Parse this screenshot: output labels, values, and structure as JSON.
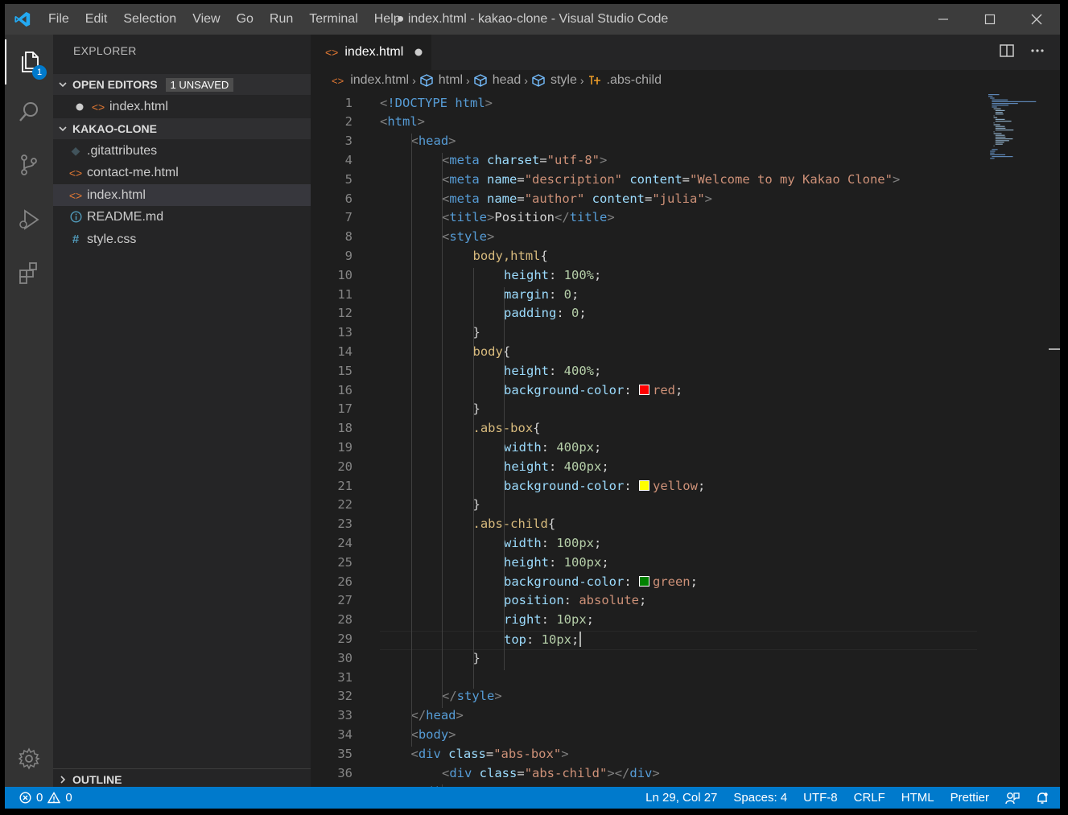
{
  "window": {
    "title": "● index.html - kakao-clone - Visual Studio Code",
    "menu": [
      "File",
      "Edit",
      "Selection",
      "View",
      "Go",
      "Run",
      "Terminal",
      "Help"
    ]
  },
  "activity": {
    "explorer_badge": "1"
  },
  "sidebar": {
    "title": "EXPLORER",
    "open_editors": {
      "label": "OPEN EDITORS",
      "badge": "1 UNSAVED",
      "file": "index.html"
    },
    "project": {
      "label": "KAKAO-CLONE",
      "files": [
        {
          "name": ".gitattributes",
          "icon": "git-icon"
        },
        {
          "name": "contact-me.html",
          "icon": "html-icon"
        },
        {
          "name": "index.html",
          "icon": "html-icon",
          "selected": true
        },
        {
          "name": "README.md",
          "icon": "info-icon"
        },
        {
          "name": "style.css",
          "icon": "hash-icon"
        }
      ]
    },
    "outline": "OUTLINE"
  },
  "editor": {
    "tab": "index.html",
    "breadcrumb": [
      "index.html",
      "html",
      "head",
      "style",
      ".abs-child"
    ],
    "cursor_line": 29,
    "lines": [
      "<!DOCTYPE html>",
      "<html>",
      "<head>",
      "<meta charset=\"utf-8\">",
      "<meta name=\"description\" content=\"Welcome to my Kakao Clone\">",
      "<meta name=\"author\" content=\"julia\">",
      "<title>Position</title>",
      "<style>",
      "body,html{",
      "height: 100%;",
      "margin: 0;",
      "padding: 0;",
      "}",
      "body{",
      "height: 400%;",
      "background-color: red;",
      "}",
      ".abs-box{",
      "width: 400px;",
      "height: 400px;",
      "background-color: yellow;",
      "}",
      ".abs-child{",
      "width: 100px;",
      "height: 100px;",
      "background-color: green;",
      "position: absolute;",
      "right: 10px;",
      "top: 10px;",
      "}",
      "",
      "</style>",
      "</head>",
      "<body>",
      "<div class=\"abs-box\">",
      "<div class=\"abs-child\"></div>",
      "</div>"
    ]
  },
  "status": {
    "errors": "0",
    "warnings": "0",
    "position": "Ln 29, Col 27",
    "spaces": "Spaces: 4",
    "encoding": "UTF-8",
    "eol": "CRLF",
    "language": "HTML",
    "formatter": "Prettier"
  },
  "colors": {
    "accent": "#007acc",
    "swatch_red": "#ff0000",
    "swatch_yellow": "#ffff00",
    "swatch_green": "#008000"
  }
}
